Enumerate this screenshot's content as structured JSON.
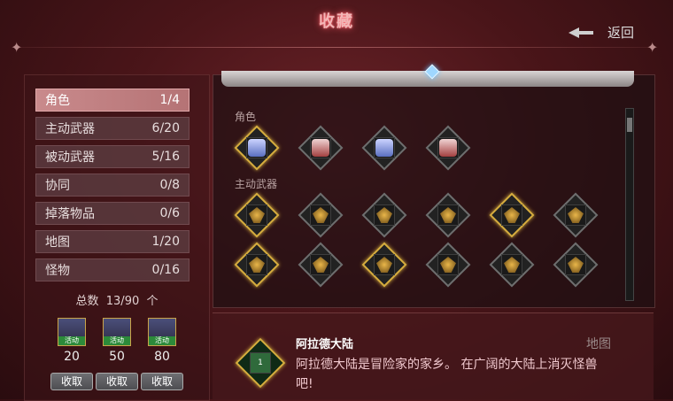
{
  "title": "收藏",
  "back_label": "返回",
  "categories": [
    {
      "label": "角色",
      "count": "1/4",
      "active": true
    },
    {
      "label": "主动武器",
      "count": "6/20"
    },
    {
      "label": "被动武器",
      "count": "5/16"
    },
    {
      "label": "协同",
      "count": "0/8"
    },
    {
      "label": "掉落物品",
      "count": "0/6"
    },
    {
      "label": "地图",
      "count": "1/20"
    },
    {
      "label": "怪物",
      "count": "0/16"
    }
  ],
  "total": {
    "label": "总数",
    "value": "13/90",
    "unit": "个"
  },
  "rewards": [
    {
      "tag": "活动",
      "amount": "20",
      "claim": "收取"
    },
    {
      "tag": "活动",
      "amount": "50",
      "claim": "收取"
    },
    {
      "tag": "活动",
      "amount": "80",
      "claim": "收取"
    }
  ],
  "sections": {
    "characters_label": "角色",
    "weapons_label": "主动武器"
  },
  "detail": {
    "name": "阿拉德大陆",
    "type": "地图",
    "description": "阿拉德大陆是冒险家的家乡。 在广阔的大陆上消灭怪兽吧!",
    "badge": "1"
  },
  "colors": {
    "accent": "#d7ad3e",
    "active_tab": "#c98a8c",
    "title_glow": "#ff5a64"
  }
}
